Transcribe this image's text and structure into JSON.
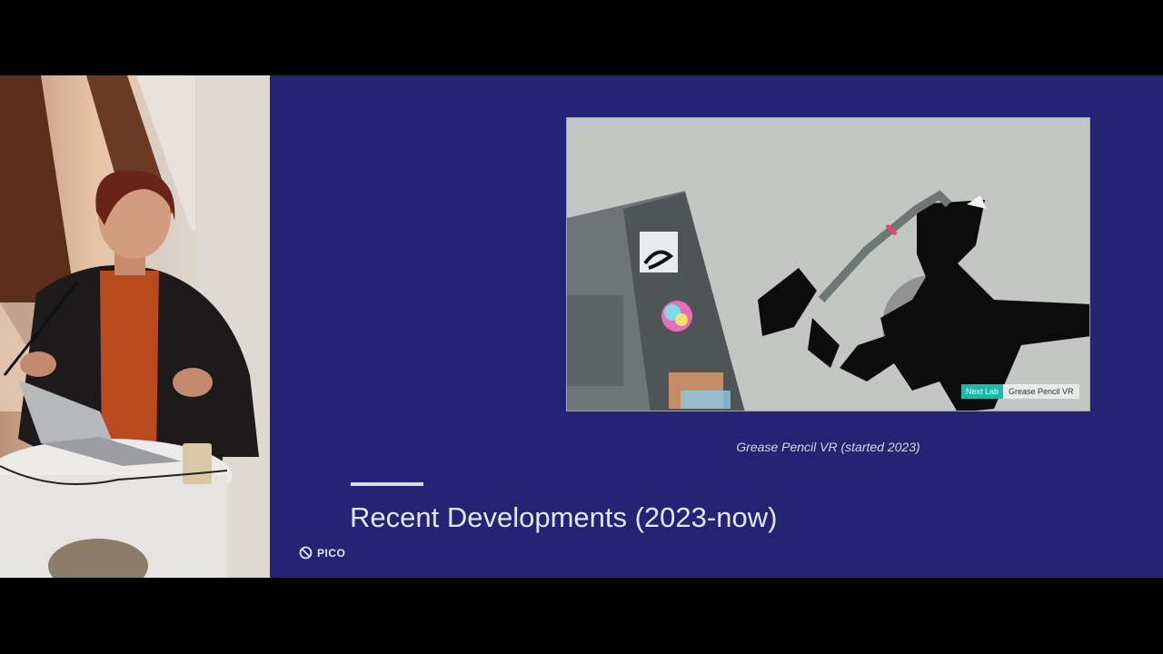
{
  "slide": {
    "caption": "Grease Pencil VR (started 2023)",
    "title": "Recent Developments (2023-now)",
    "brand": "PICO",
    "brand_icon": "pico-logo-icon",
    "background_color": "#232473"
  },
  "demo_screenshot": {
    "overlay_tag_primary": "Next Lab",
    "overlay_tag_secondary": "Grease Pencil VR",
    "accent_color": "#1fb7a6"
  },
  "camera": {
    "subject": "presenter at lectern with laptop"
  }
}
